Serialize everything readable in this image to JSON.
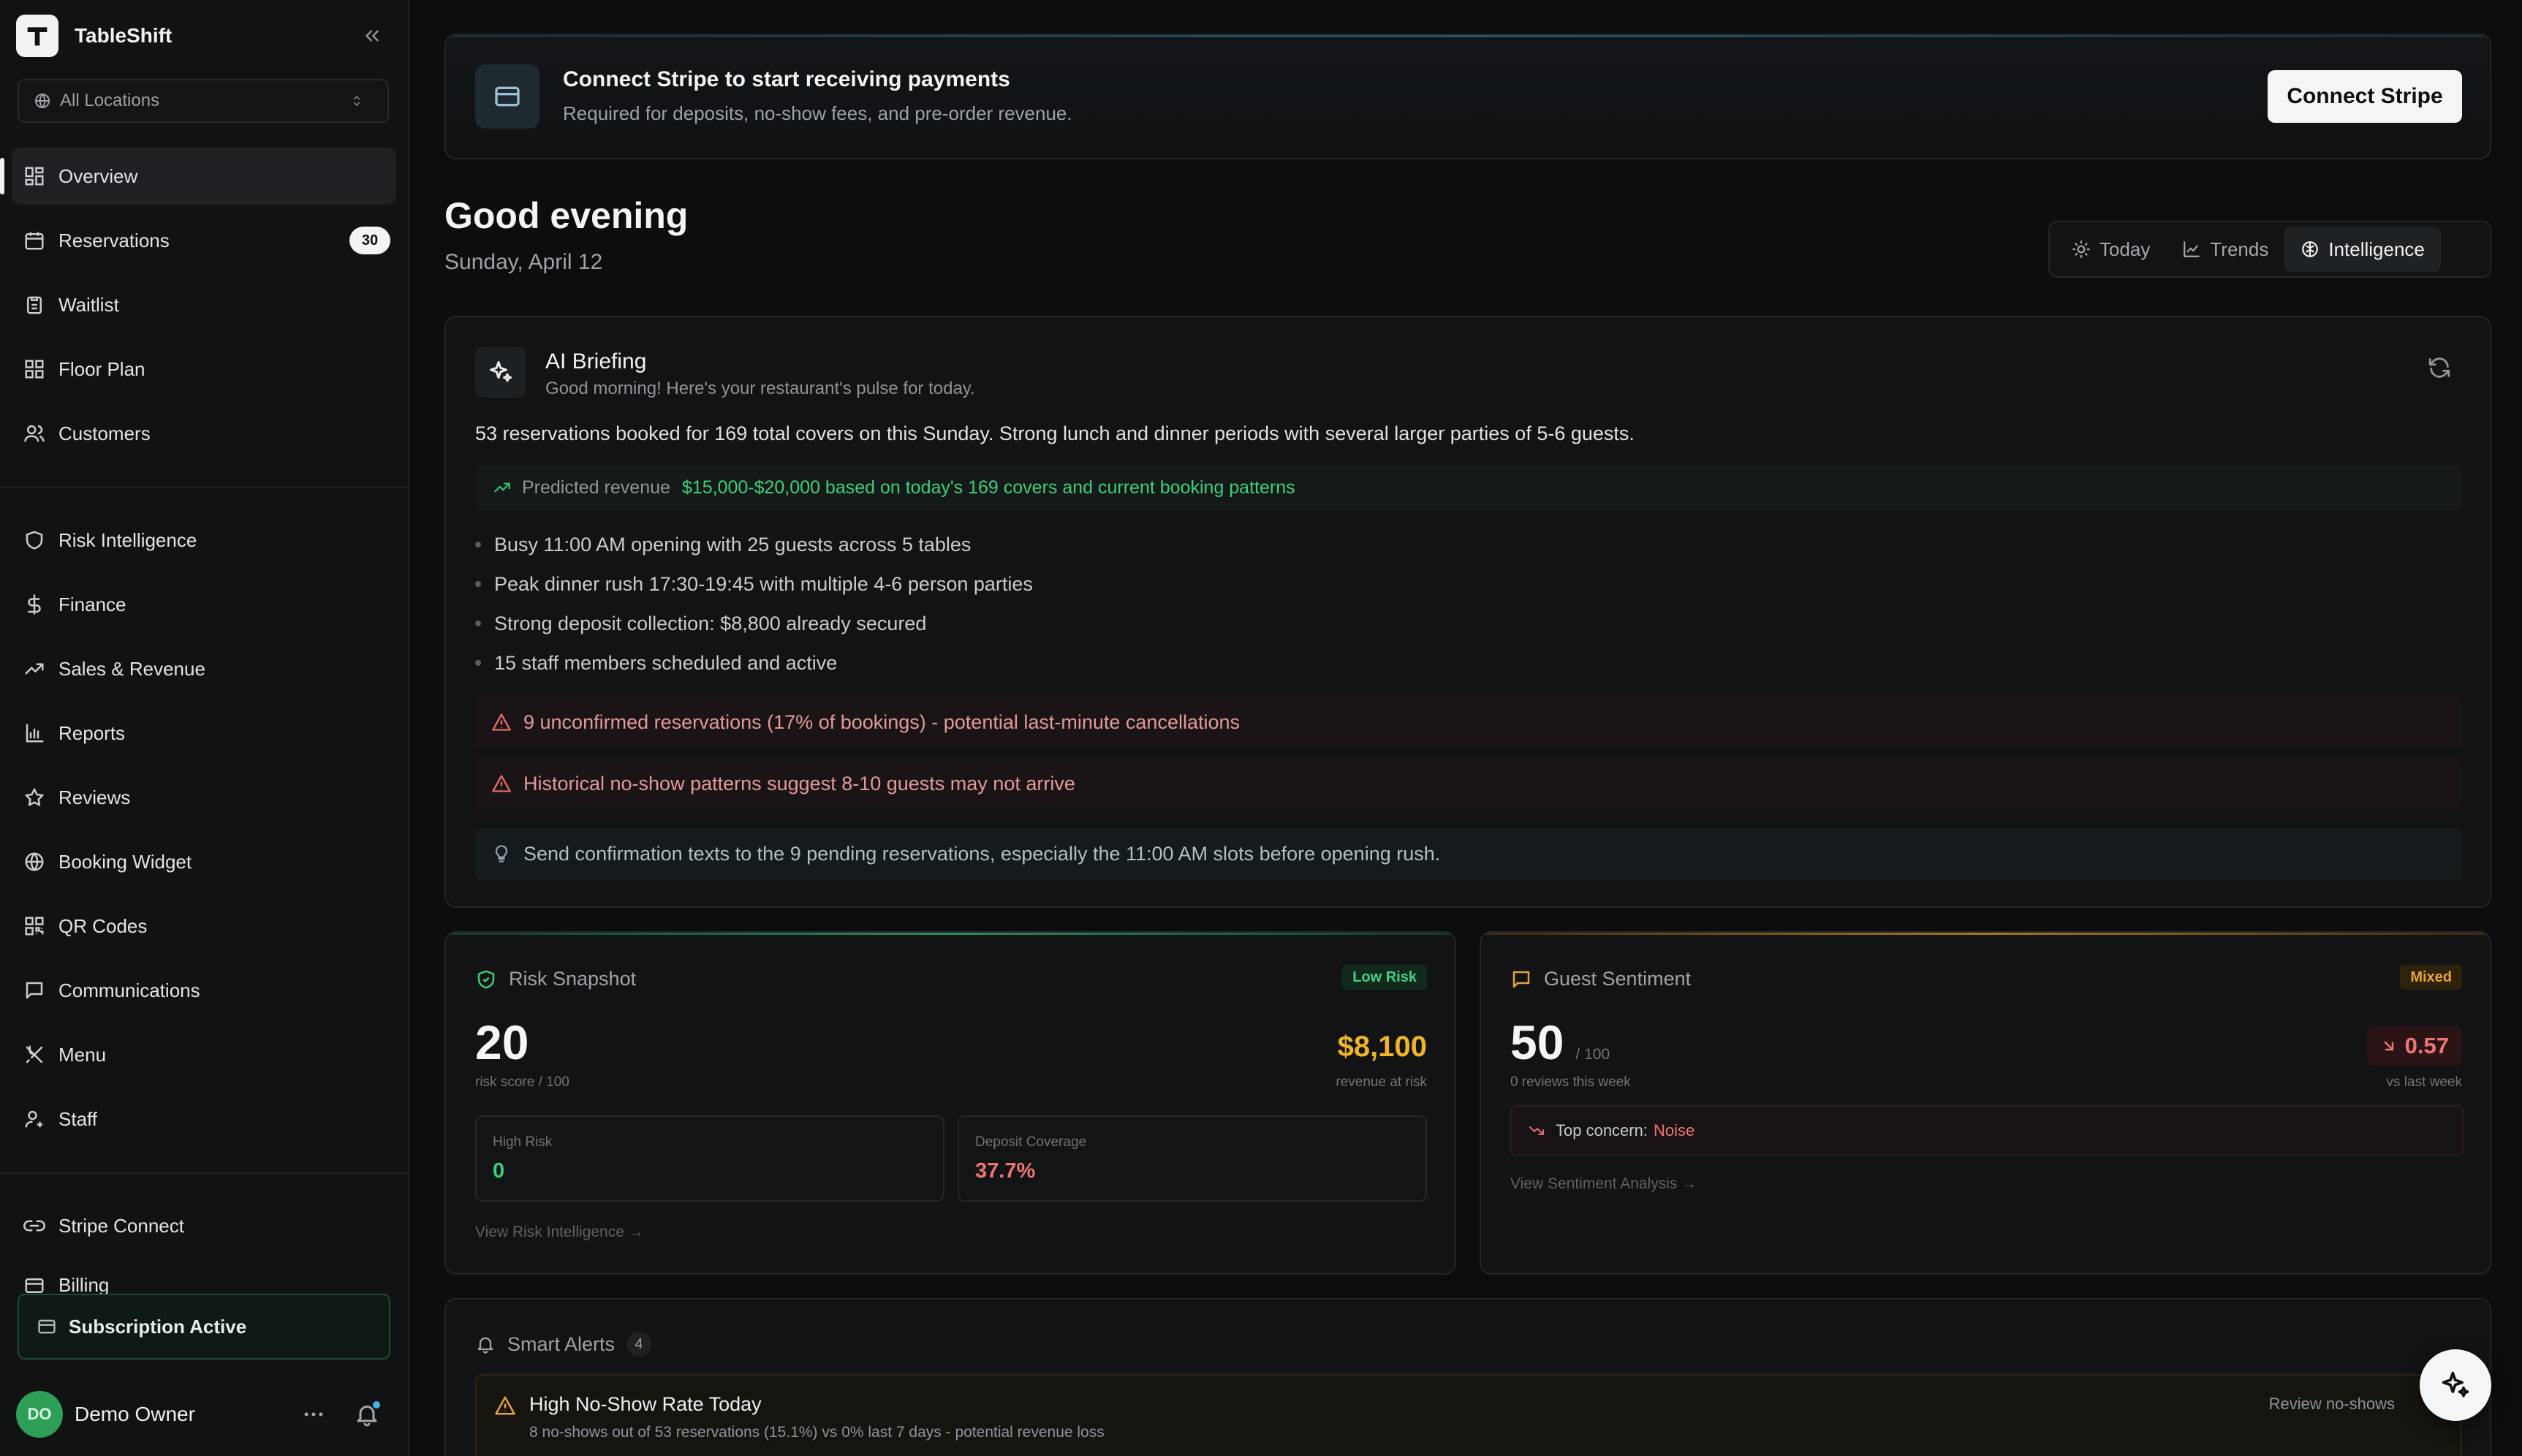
{
  "app": {
    "name": "TableShift"
  },
  "sidebar": {
    "location_select": "All Locations",
    "primary": [
      {
        "label": "Overview"
      },
      {
        "label": "Reservations",
        "badge": "30"
      },
      {
        "label": "Waitlist"
      },
      {
        "label": "Floor Plan"
      },
      {
        "label": "Customers"
      }
    ],
    "secondary": [
      {
        "label": "Risk Intelligence"
      },
      {
        "label": "Finance"
      },
      {
        "label": "Sales & Revenue"
      },
      {
        "label": "Reports"
      },
      {
        "label": "Reviews"
      },
      {
        "label": "Booking Widget"
      },
      {
        "label": "QR Codes"
      },
      {
        "label": "Communications"
      },
      {
        "label": "Menu"
      },
      {
        "label": "Staff"
      }
    ],
    "tertiary": [
      {
        "label": "Stripe Connect"
      },
      {
        "label": "Billing"
      }
    ],
    "subscription": "Subscription Active",
    "user": {
      "initials": "DO",
      "name": "Demo Owner"
    }
  },
  "banner": {
    "title": "Connect Stripe to start receiving payments",
    "subtitle": "Required for deposits, no-show fees, and pre-order revenue.",
    "button": "Connect Stripe"
  },
  "header": {
    "greeting": "Good evening",
    "date": "Sunday, April 12",
    "tabs": [
      {
        "label": "Today"
      },
      {
        "label": "Trends"
      },
      {
        "label": "Intelligence",
        "active": true
      }
    ]
  },
  "briefing": {
    "title": "AI Briefing",
    "subtitle": "Good morning! Here's your restaurant's pulse for today.",
    "summary": "53 reservations booked for 169 total covers on this Sunday. Strong lunch and dinner periods with several larger parties of 5-6 guests.",
    "predicted_label": "Predicted revenue",
    "predicted_value": "$15,000-$20,000 based on today's 169 covers and current booking patterns",
    "bullets": [
      "Busy 11:00 AM opening with 25 guests across 5 tables",
      "Peak dinner rush 17:30-19:45 with multiple 4-6 person parties",
      "Strong deposit collection: $8,800 already secured",
      "15 staff members scheduled and active"
    ],
    "warnings": [
      "9 unconfirmed reservations (17% of bookings) - potential last-minute cancellations",
      "Historical no-show patterns suggest 8-10 guests may not arrive"
    ],
    "tip": "Send confirmation texts to the 9 pending reservations, especially the 11:00 AM slots before opening rush."
  },
  "risk": {
    "title": "Risk Snapshot",
    "level": "Low Risk",
    "score": "20",
    "score_label": "risk score / 100",
    "revenue": "$8,100",
    "revenue_label": "revenue at risk",
    "high_risk_label": "High Risk",
    "high_risk_value": "0",
    "deposit_label": "Deposit Coverage",
    "deposit_value": "37.7%",
    "link": "View Risk Intelligence →"
  },
  "sentiment": {
    "title": "Guest Sentiment",
    "level": "Mixed",
    "score": "50",
    "denominator": "/ 100",
    "reviews": "0 reviews this week",
    "delta": "0.57",
    "delta_label": "vs last week",
    "concern_label": "Top concern:",
    "concern_value": "Noise",
    "link": "View Sentiment Analysis →"
  },
  "alerts": {
    "title": "Smart Alerts",
    "count": "4",
    "item": {
      "title": "High No-Show Rate Today",
      "subtitle": "8 no-shows out of 53 reservations (15.1%) vs 0% last 7 days - potential revenue loss",
      "action": "Review no-shows"
    }
  },
  "colors": {
    "accent_green": "#3ccf7d",
    "accent_amber": "#f0b429",
    "accent_red": "#f07474",
    "background": "#0c0d0e"
  }
}
